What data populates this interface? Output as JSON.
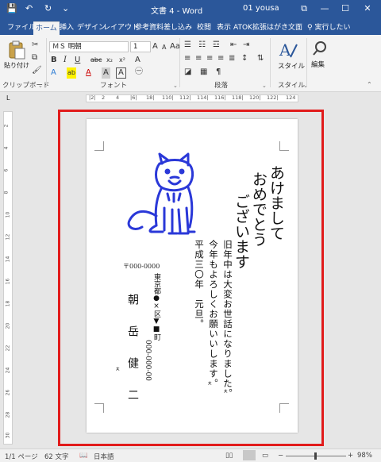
{
  "window": {
    "title": "文書 4 - Word",
    "user": "01 yousa",
    "qa_save": "💾",
    "qa_undo": "↶",
    "qa_redo": "↻",
    "qa_more": "⌄",
    "btn_ribbon": "⧉",
    "btn_min": "—",
    "btn_max": "☐",
    "btn_close": "✕"
  },
  "tabs": [
    "ファイル",
    "ホーム",
    "挿入",
    "デザイン",
    "レイアウト",
    "参考資料",
    "差し込み",
    "校閲",
    "表示",
    "ATOK拡張",
    "はがき文面"
  ],
  "tell_me": "実行したい",
  "ribbon": {
    "paste_label": "貼り付け",
    "clipboard_label": "クリップボード",
    "font_name": "ＭＳ 明朝",
    "font_size": "1",
    "font_label": "フォント",
    "paragraph_label": "段落",
    "style_button": "スタイル",
    "style_group_label": "スタイル",
    "edit_button": "編集",
    "bold": "B",
    "italic": "I",
    "underline": "U",
    "strike": "abc",
    "subscript": "x₂",
    "superscript": "x²",
    "font_a_big": "A",
    "font_a_small": "A",
    "font_aa": "Aa",
    "clear": "A",
    "text_effect": "A",
    "highlight": "ab",
    "font_color": "A",
    "char_shade": "A",
    "char_border": "A",
    "expander": "⌄"
  },
  "ruler": {
    "corner": "L",
    "numbers": [
      "|2|",
      "2",
      "4",
      "|6|",
      "18|",
      "110|",
      "112|",
      "114|",
      "116|",
      "118|",
      "120|",
      "122|",
      "124"
    ]
  },
  "vruler_numbers": [
    "2",
    "4",
    "6",
    "8",
    "10",
    "12",
    "14",
    "16",
    "18",
    "20",
    "22",
    "24",
    "26",
    "28",
    "30"
  ],
  "postcard": {
    "greeting_col1": "あけまして",
    "greeting_col2": "おめでとう",
    "greeting_col3": "ございます",
    "message_col1": "旧年中は大変お世話になりました。",
    "message_col2": "今年もよろしくお願いいします。",
    "message_col3": "平成三〇年　元旦。",
    "postal_code": "〒000-0000",
    "address": "東京都●×区▼■町",
    "phone": "000-000-00",
    "name": "朝　岳　健　二",
    "mark_small": "ㅊ"
  },
  "status": {
    "page": "1/1 ページ",
    "words": "62 文字",
    "proof_icon": "📖",
    "language": "日本語",
    "zoom_minus": "−",
    "zoom_plus": "+",
    "zoom": "98%",
    "zoom_level": 0.98
  },
  "colors": {
    "title_bar": "#2b579a",
    "dog_stamp": "#2a38d8",
    "red_frame": "#e11b1b"
  }
}
